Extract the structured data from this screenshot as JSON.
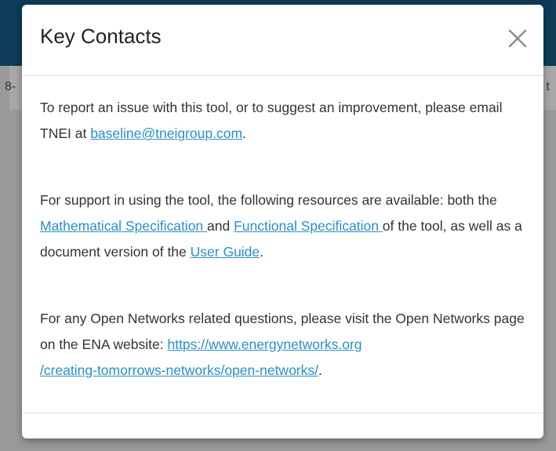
{
  "background": {
    "fragment_left": "8-",
    "fragment_right": "t"
  },
  "modal": {
    "title": "Key Contacts",
    "close_icon": "close-icon",
    "para1": {
      "text_a": "To report an issue with this tool, or to suggest an improvement, please email TNEI at ",
      "email_link": "baseline@tneigroup.com",
      "text_b": "."
    },
    "para2": {
      "text_a": "For support in using the tool, the following resources are available: both the ",
      "link_math": "Mathematical Specification ",
      "text_b": "and ",
      "link_func": "Functional Specification ",
      "text_c": "of the tool, as well as a document version of the ",
      "link_guide": "User Guide",
      "text_d": "."
    },
    "para3": {
      "text_a": "For any Open Networks related questions, please visit the Open Networks page on the ENA website: ",
      "link_ena": "https://www.energynetworks.org/creating-tomorrows-networks/open-networks/",
      "text_b": "."
    }
  },
  "colors": {
    "header_bg": "#0e3b57",
    "overlay": "#9a9a9a",
    "link": "#2a8fc9"
  }
}
